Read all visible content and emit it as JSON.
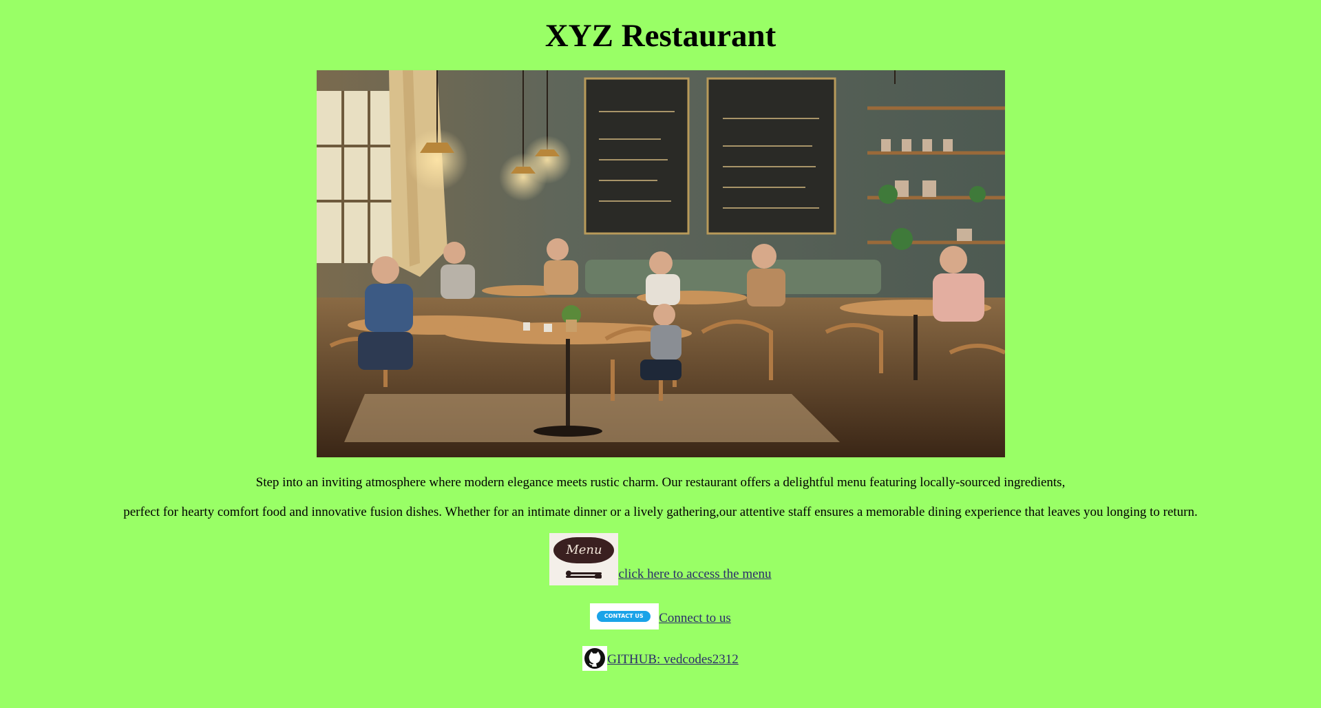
{
  "page": {
    "title": "XYZ Restaurant",
    "background_color": "#99ff66"
  },
  "hero_image": {
    "icon": "restaurant-interior-image"
  },
  "description": {
    "line1": "Step into an inviting atmosphere where modern elegance meets rustic charm. Our restaurant offers a delightful menu featuring locally-sourced ingredients,",
    "line2": "perfect for hearty comfort food and innovative fusion dishes. Whether for an intimate dinner or a lively gathering,our attentive staff ensures a memorable dining experience that leaves you longing to return."
  },
  "links": {
    "menu": {
      "icon": "menu-sign-icon",
      "thumb_text": "Menu",
      "label": "click here to access the menu"
    },
    "contact": {
      "icon": "contact-us-badge-icon",
      "thumb_text": "CONTACT US",
      "label": "Connect to us"
    },
    "github": {
      "icon": "github-icon",
      "label": "GITHUB: vedcodes2312"
    }
  },
  "colors": {
    "link": "#2b2b6b",
    "contact_badge": "#1aa3e8",
    "menu_sign": "#3a2020"
  }
}
